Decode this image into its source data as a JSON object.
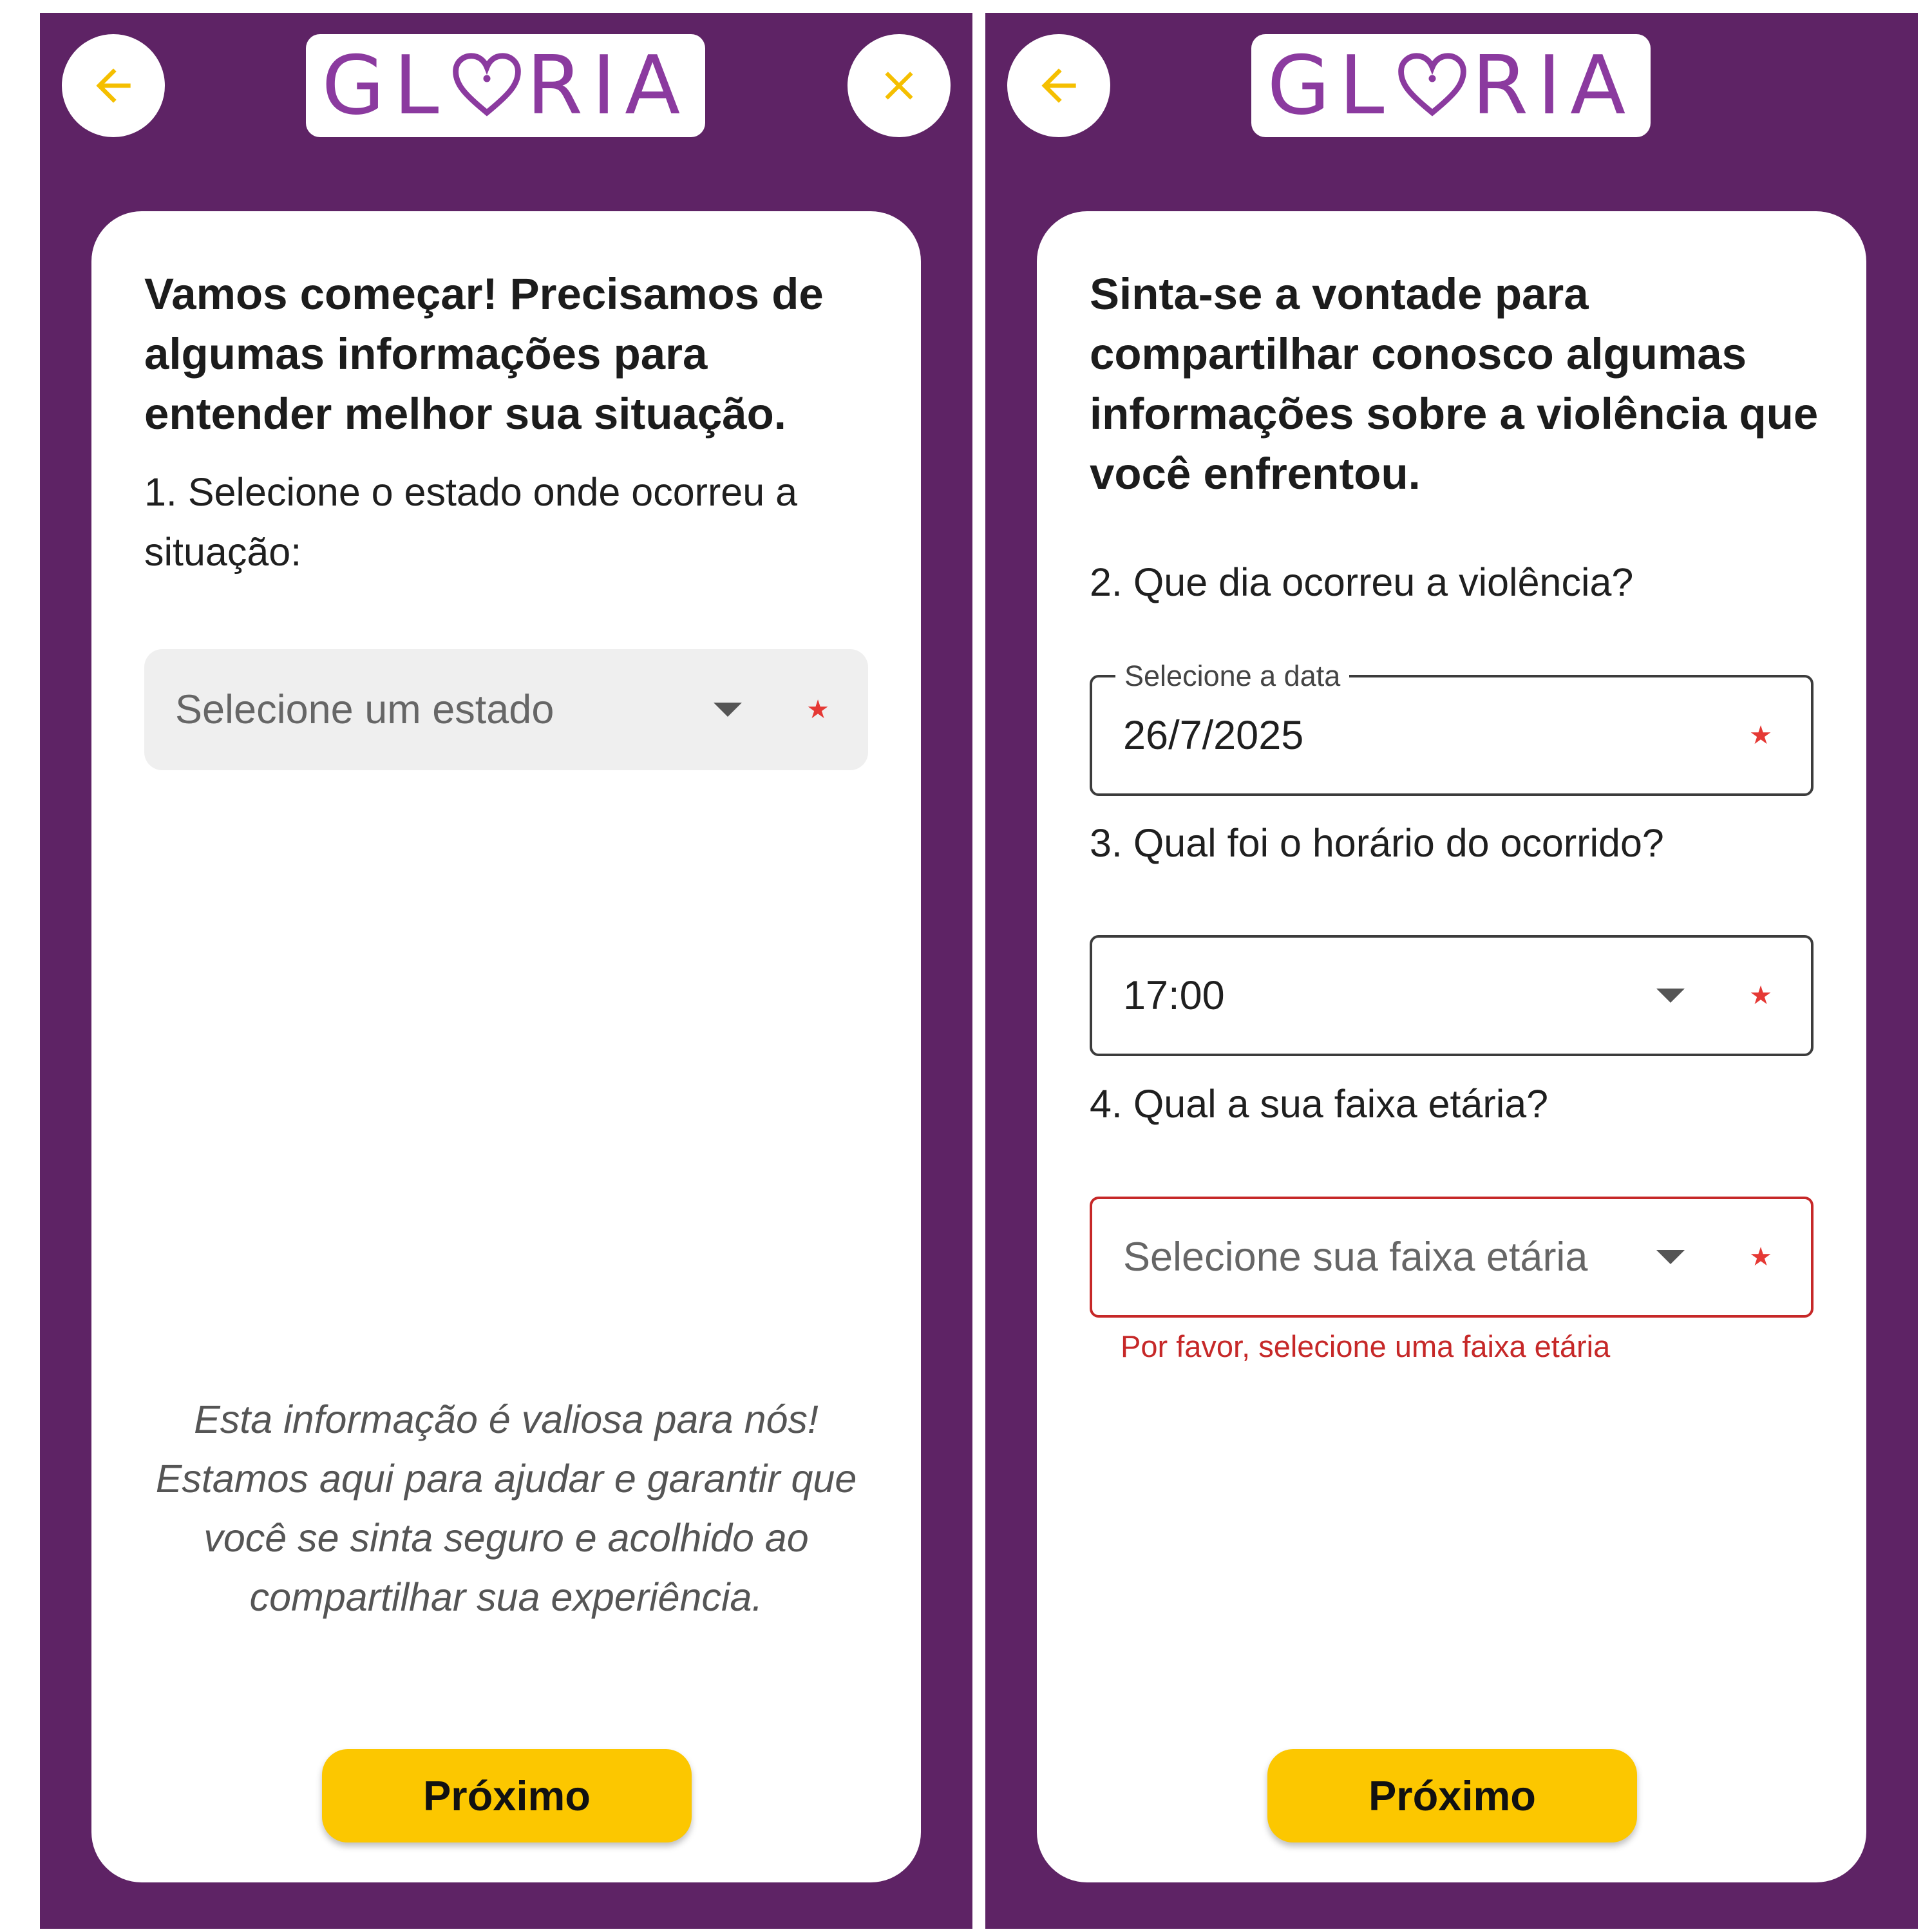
{
  "brand": {
    "logo_text": "GLORIA",
    "accent_color": "#fcc700",
    "bg_color": "#5e2365",
    "logo_color": "#8b3a9f",
    "error_color": "#c62828",
    "required_color": "#e53935"
  },
  "screen1": {
    "title": "Vamos começar! Precisamos de algumas informações para entender melhor sua situação.",
    "question": "1. Selecione o estado onde ocorreu a situação:",
    "state_placeholder": "Selecione um estado",
    "required_mark": "★",
    "note": "Esta informação é valiosa para nós! Estamos aqui para ajudar e garantir que você se sinta seguro e acolhido ao compartilhar sua experiência.",
    "next_label": "Próximo",
    "icons": {
      "back": "arrow-left-icon",
      "close": "close-icon"
    }
  },
  "screen2": {
    "title": "Sinta-se a vontade para compartilhar conosco algumas informações sobre a violência que você enfrentou.",
    "q2": "2. Que dia ocorreu a violência?",
    "date_label": "Selecione a data",
    "date_value": "26/7/2025",
    "q3": "3. Qual foi o horário do ocorrido?",
    "time_value": "17:00",
    "q4": "4. Qual a sua faixa etária?",
    "age_placeholder": "Selecione sua faixa etária",
    "age_error": "Por favor, selecione uma faixa etária",
    "required_mark": "★",
    "next_label": "Próximo",
    "icons": {
      "back": "arrow-left-icon"
    }
  }
}
